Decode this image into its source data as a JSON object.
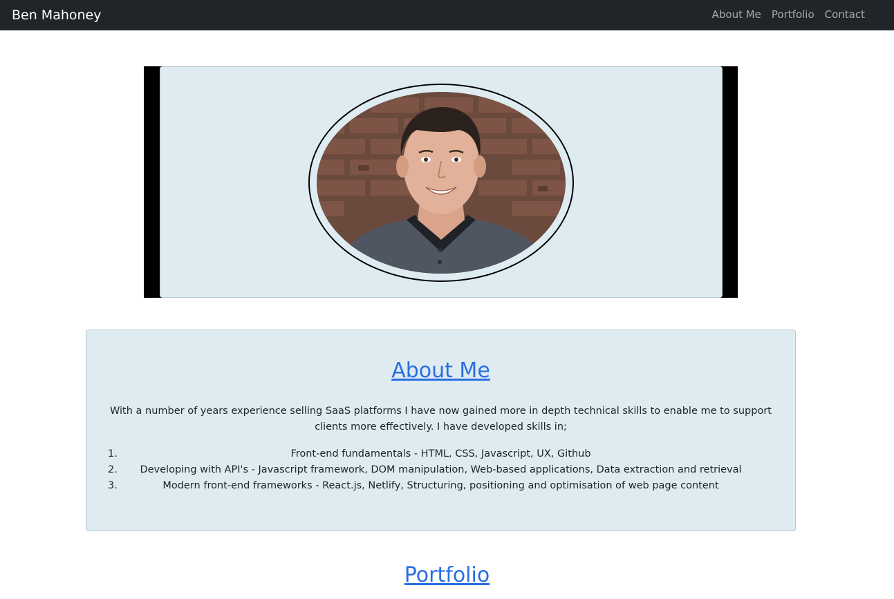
{
  "navbar": {
    "brand": "Ben Mahoney",
    "links": [
      "About Me",
      "Portfolio",
      "Contact"
    ]
  },
  "about": {
    "title": "About Me",
    "intro": "With a number of years experience selling SaaS platforms I have now gained more in depth technical skills to enable me to support clients more effectively. I have developed skills in;",
    "skills": [
      {
        "num": "1.",
        "text": "Front-end fundamentals - HTML, CSS, Javascript, UX, Github"
      },
      {
        "num": "2.",
        "text": "Developing with API's - Javascript framework, DOM manipulation, Web-based applications, Data extraction and retrieval"
      },
      {
        "num": "3.",
        "text": "Modern front-end frameworks - React.js, Netlify, Structuring, positioning and optimisation of web page content"
      }
    ]
  },
  "portfolio": {
    "title": "Portfolio"
  },
  "colors": {
    "navbar_bg": "#212529",
    "card_bg": "#deecf1",
    "link_blue": "#2a6ee0"
  }
}
